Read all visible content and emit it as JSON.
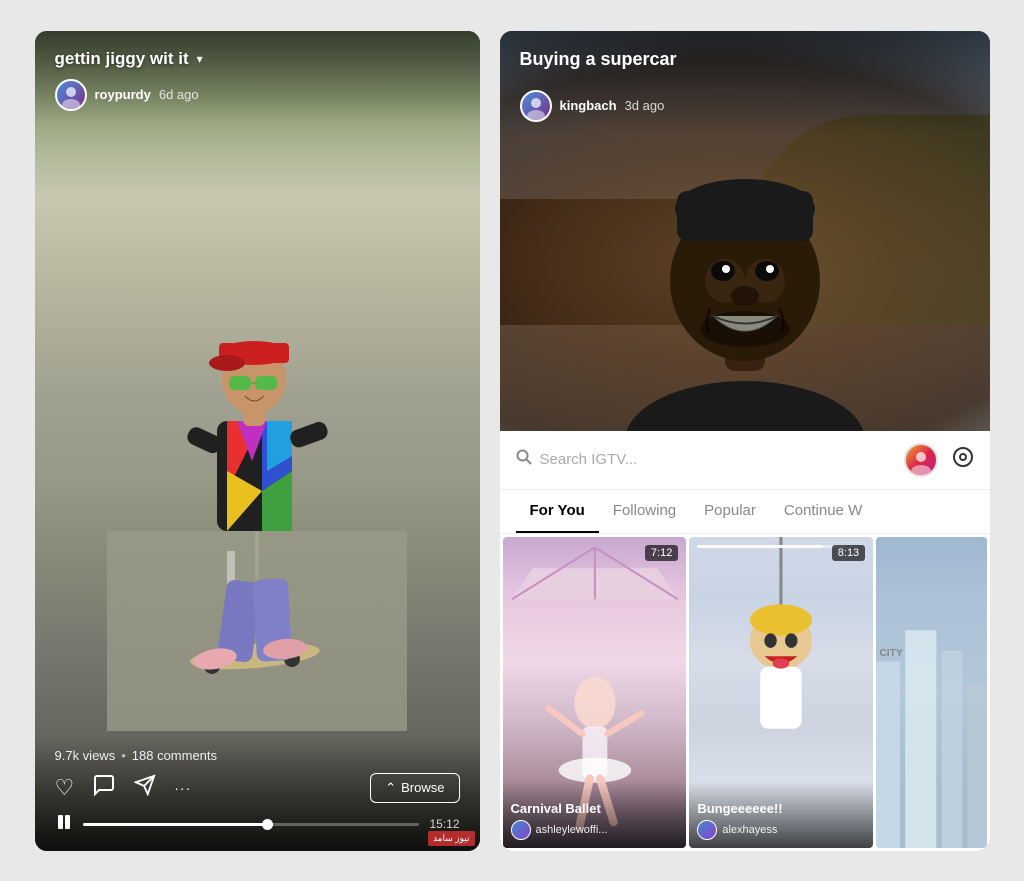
{
  "left_panel": {
    "video_title": "gettin jiggy wit it",
    "dropdown": "▾",
    "username": "roypurdy",
    "time_ago": "6d ago",
    "views": "9.7k views",
    "comments": "188 comments",
    "browse_label": "Browse",
    "browse_icon": "⌃",
    "duration": "15:12",
    "progress_percent": 55,
    "actions": {
      "like": "♡",
      "comment": "💬",
      "share": "✈",
      "more": "···"
    }
  },
  "right_panel": {
    "video_title": "Buying a supercar",
    "username": "kingbach",
    "time_ago": "3d ago",
    "search_placeholder": "Search IGTV...",
    "tabs": [
      {
        "label": "For You",
        "active": true
      },
      {
        "label": "Following",
        "active": false
      },
      {
        "label": "Popular",
        "active": false
      },
      {
        "label": "Continue W",
        "active": false
      }
    ],
    "cards": [
      {
        "title": "Carnival Ballet",
        "author": "ashleylewoffi...",
        "duration": "7:12"
      },
      {
        "title": "Bungeeeeee!!",
        "author": "alexhayess",
        "duration": "8:13"
      },
      {
        "title": "",
        "author": "",
        "duration": ""
      }
    ]
  }
}
